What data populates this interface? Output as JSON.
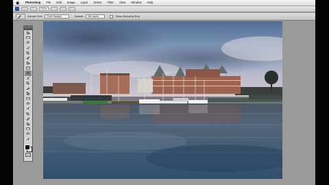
{
  "menubar": {
    "app_name": "Photoshop",
    "menus": [
      "File",
      "Edit",
      "Image",
      "Layer",
      "Select",
      "Filter",
      "View",
      "Window",
      "Help"
    ]
  },
  "appbar": {
    "zoom_value": "100%"
  },
  "options": {
    "feather_label": "Sample Size:",
    "feather_value": "Point Sample",
    "sample_label": "Sample:",
    "sample_value": "All Layers",
    "show_ring_label": "Show Sampling Ring",
    "show_ring_checked": true
  },
  "tools": [
    "move-tool",
    "marquee-tool",
    "lasso-tool",
    "quick-selection-tool",
    "crop-tool",
    "eyedropper-tool",
    "spot-healing-tool",
    "brush-tool",
    "clone-stamp-tool",
    "history-brush-tool",
    "eraser-tool",
    "gradient-tool",
    "blur-tool",
    "dodge-tool",
    "pen-tool",
    "type-tool",
    "path-selection-tool",
    "shape-tool",
    "3d-rotate-tool",
    "3d-orbit-tool",
    "hand-tool",
    "zoom-tool"
  ],
  "colors": {
    "workspace": "#9a9a9a",
    "foreground": "#000000",
    "background": "#ffffff"
  }
}
